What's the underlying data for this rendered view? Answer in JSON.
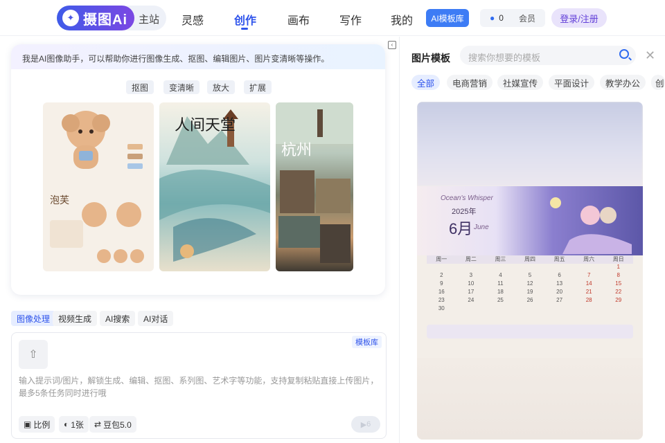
{
  "nav": {
    "logo_text": "摄图Ai",
    "home_label": "主站",
    "items": [
      "灵感",
      "创作",
      "画布",
      "写作",
      "我的"
    ],
    "active_item": "创作",
    "template_button": "AI模板库",
    "points_value": "0",
    "vip_label": "会员",
    "login_label": "登录/注册",
    "accent_color": "#2f54eb"
  },
  "assistant": {
    "intro": "我是AI图像助手，可以帮助你进行图像生成、抠图、编辑图片、图片变清晰等操作。",
    "quick_actions": [
      "抠图",
      "变清晰",
      "放大",
      "扩展"
    ],
    "samples": {
      "poodle_title": "泡芙",
      "landscape_title": "人间天堂",
      "city_title": "杭州"
    }
  },
  "composer": {
    "mode_tabs": [
      "图像处理",
      "视频生成",
      "AI搜索",
      "AI对话"
    ],
    "active_mode": "图像处理",
    "template_link": "模板库",
    "placeholder": "输入提示词/图片，解锁生成、编辑、抠图、系列图、艺术字等功能，支持复制粘贴直接上传图片，最多5条任务同时进行哦",
    "options": {
      "ratio": "比例",
      "count": "1张",
      "model": "豆包5.0"
    },
    "send_count": "6"
  },
  "template_panel": {
    "title": "图片模板",
    "search_placeholder": "搜索你想要的模板",
    "categories": [
      "全部",
      "电商营销",
      "社媒宣传",
      "平面设计",
      "教学办公",
      "创"
    ],
    "active_category": "全部",
    "card": {
      "subtitle": "Ocean's Whisper",
      "year": "2025年",
      "month": "6月",
      "month_en": "June",
      "weekdays": [
        "周一",
        "周二",
        "周三",
        "周四",
        "周五",
        "周六",
        "周日"
      ],
      "weeks": [
        [
          "",
          "",
          "",
          "",
          "",
          "",
          "1"
        ],
        [
          "2",
          "3",
          "4",
          "5",
          "6",
          "7",
          "8"
        ],
        [
          "9",
          "10",
          "11",
          "12",
          "13",
          "14",
          "15"
        ],
        [
          "16",
          "17",
          "18",
          "19",
          "20",
          "21",
          "22"
        ],
        [
          "23",
          "24",
          "25",
          "26",
          "27",
          "28",
          "29"
        ],
        [
          "30",
          "",
          "",
          "",
          "",
          "",
          ""
        ]
      ]
    }
  }
}
